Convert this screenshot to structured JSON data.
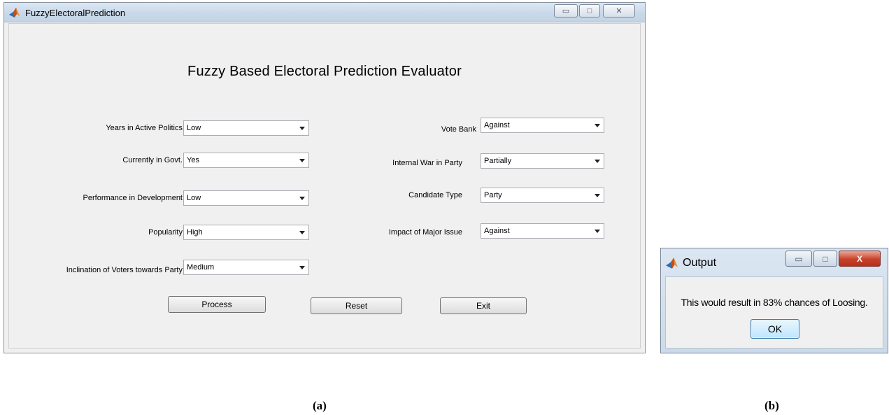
{
  "window_a": {
    "title": "FuzzyElectoralPrediction",
    "controls": {
      "minimize": "▭",
      "maximize": "□",
      "close": "✕"
    },
    "heading": "Fuzzy Based Electoral Prediction Evaluator",
    "left_fields": [
      {
        "label": "Years in Active Politics",
        "value": "Low"
      },
      {
        "label": "Currently in Govt.",
        "value": "Yes"
      },
      {
        "label": "Performance in Development",
        "value": "Low"
      },
      {
        "label": "Popularity",
        "value": "High"
      },
      {
        "label": "Inclination of Voters towards Party",
        "value": "Medium"
      }
    ],
    "right_fields": [
      {
        "label": "Vote Bank",
        "value": "Against"
      },
      {
        "label": "Internal War in Party",
        "value": "Partially"
      },
      {
        "label": "Candidate Type",
        "value": "Party"
      },
      {
        "label": "Impact of Major Issue",
        "value": "Against"
      }
    ],
    "buttons": {
      "process": "Process",
      "reset": "Reset",
      "exit": "Exit"
    }
  },
  "window_b": {
    "title": "Output",
    "controls": {
      "minimize": "▭",
      "maximize": "□",
      "close": "X"
    },
    "message": "This would result in 83% chances of Loosing.",
    "ok": "OK"
  },
  "captions": {
    "a": "(a)",
    "b": "(b)"
  },
  "colors": {
    "window_bg": "#f0f0f0",
    "titlebar": "#c8d8e9",
    "close_red": "#c8412a",
    "ok_border": "#3c7fb1"
  },
  "icons": {
    "app": "matlab-logo-icon"
  }
}
